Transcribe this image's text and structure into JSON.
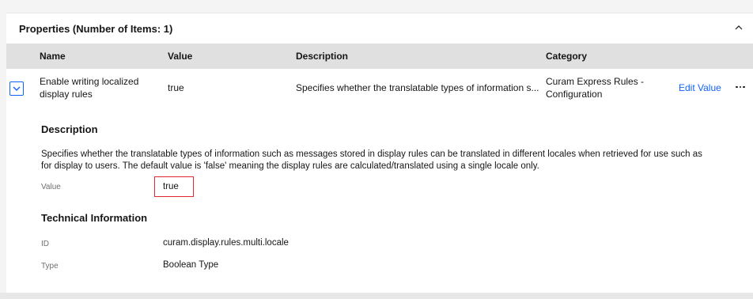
{
  "panel": {
    "title": "Properties (Number of Items: 1)",
    "collapse_icon": "chevron-up-icon"
  },
  "table": {
    "columns": [
      "Name",
      "Value",
      "Description",
      "Category"
    ],
    "row": {
      "name_line1": "Enable writing localized",
      "name_line2": "display rules",
      "value": "true",
      "description": "Specifies whether the translatable types of information s...",
      "category_line1": "Curam Express Rules -",
      "category_line2": "Configuration",
      "edit_label": "Edit Value",
      "expand_icon": "chevron-down-icon",
      "overflow_icon": "overflow-menu-icon"
    }
  },
  "details": {
    "description_title": "Description",
    "description_line1": "Specifies whether the translatable types of information such as messages stored in display rules can be translated in different locales when retrieved for use such as",
    "description_line2": "for display to users. The default value is 'false' meaning the display rules are calculated/translated using a single locale only.",
    "value_label": "Value",
    "value": "true",
    "tech_title": "Technical Information",
    "id_label": "ID",
    "id_value": "curam.display.rules.multi.locale",
    "type_label": "Type",
    "type_value": "Boolean Type"
  },
  "colors": {
    "accent": "#0f62fe",
    "highlight": "#e0282e",
    "header_bg": "#e0e0e0"
  }
}
